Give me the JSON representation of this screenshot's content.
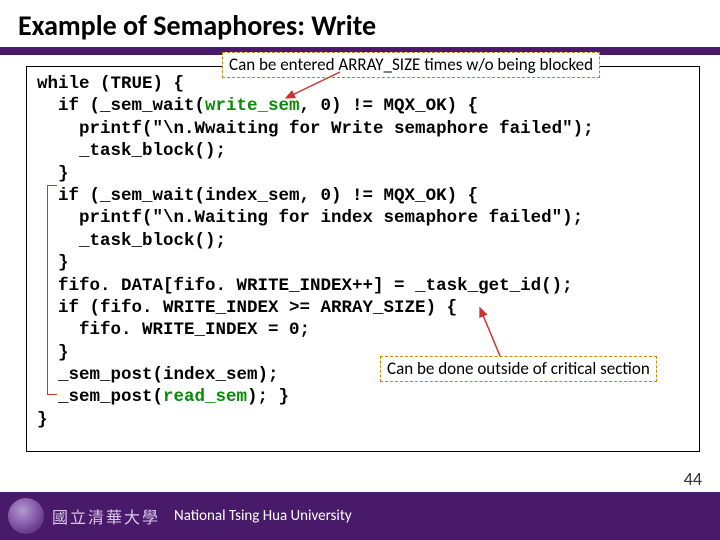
{
  "title": "Example of Semaphores: Write",
  "annot_top": "Can be entered ARRAY_SIZE times w/o being blocked",
  "annot_mid": "Can be done outside of critical section",
  "code": {
    "l1a": "while (TRUE) {",
    "l2a": "  if (_sem_wait(",
    "l2b": "write_sem",
    "l2c": ", 0) != MQX_OK) {",
    "l3": "    printf(\"\\n.Wwaiting for Write semaphore failed\");",
    "l4": "    _task_block();",
    "l5": "  }",
    "l6": "  if (_sem_wait(index_sem, 0) != MQX_OK) {",
    "l7": "    printf(\"\\n.Waiting for index semaphore failed\");",
    "l8": "    _task_block();",
    "l9": "  }",
    "l10": "  fifo. DATA[fifo. WRITE_INDEX++] = _task_get_id();",
    "l11": "  if (fifo. WRITE_INDEX >= ARRAY_SIZE) {",
    "l12": "    fifo. WRITE_INDEX = 0;",
    "l13": "  }",
    "l14": "  _sem_post(index_sem);",
    "l15a": "  _sem_post(",
    "l15b": "read_sem",
    "l15c": "); }",
    "l16": "}"
  },
  "footer": {
    "logotext": "國立清華大學",
    "university": "National Tsing Hua University"
  },
  "pagenum": "44"
}
